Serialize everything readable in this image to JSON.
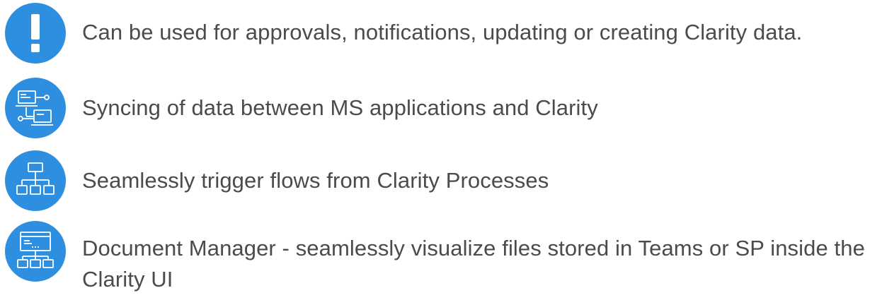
{
  "accent_color": "#2e8fe0",
  "features": [
    {
      "icon": "exclamation-icon",
      "text": "Can be used for approvals, notifications, updating or creating Clarity data."
    },
    {
      "icon": "network-computers-icon",
      "text": "Syncing of data between MS applications and Clarity"
    },
    {
      "icon": "hierarchy-icon",
      "text": "Seamlessly trigger flows from Clarity Processes"
    },
    {
      "icon": "document-manager-icon",
      "text": "Document Manager - seamlessly visualize files stored in Teams or SP inside the Clarity UI"
    }
  ]
}
